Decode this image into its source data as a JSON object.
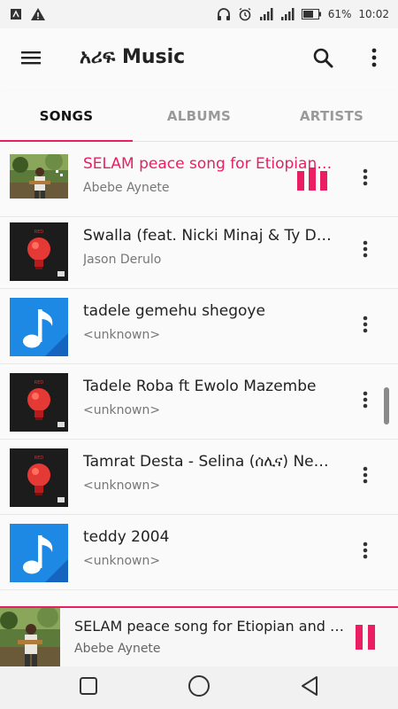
{
  "status_bar": {
    "battery": "61%",
    "time": "10:02",
    "left_icons": [
      "usb-icon",
      "warning-icon"
    ],
    "right_icons": [
      "headphones-icon",
      "alarm-icon",
      "signal-icon",
      "signal-icon",
      "battery-icon"
    ]
  },
  "app_bar": {
    "title": "አሪፍ Music",
    "icons": [
      "menu-icon",
      "search-icon",
      "more-vert-icon"
    ]
  },
  "tabs": [
    {
      "label": "SONGS",
      "active": true
    },
    {
      "label": "ALBUMS",
      "active": false
    },
    {
      "label": "ARTISTS",
      "active": false
    }
  ],
  "songs": [
    {
      "title": "SELAM peace song for Etiopian and Eritrean",
      "artist": "Abebe Aynete",
      "art": "photo",
      "playing": true
    },
    {
      "title": "Swalla (feat. Nicki Minaj & Ty Dolla $ign)",
      "artist": "Jason Derulo",
      "art": "red-bulb",
      "playing": false
    },
    {
      "title": "tadele gemehu shegoye",
      "artist": "<unknown>",
      "art": "music-note",
      "playing": false
    },
    {
      "title": "Tadele Roba ft Ewolo Mazembe",
      "artist": "<unknown>",
      "art": "red-bulb",
      "playing": false
    },
    {
      "title": "Tamrat Desta - Selina (ሰሊና) New Song",
      "artist": "<unknown>",
      "art": "red-bulb",
      "playing": false
    },
    {
      "title": "teddy 2004",
      "artist": "<unknown>",
      "art": "music-note",
      "playing": false
    }
  ],
  "now_playing": {
    "title": "SELAM peace song for Etiopian and Eritrean",
    "artist": "Abebe Aynete"
  },
  "colors": {
    "accent": "#e91e63",
    "note_blue": "#1e88e5",
    "bulb_red": "#e53935"
  },
  "nav_bar": {
    "icons": [
      "recents-icon",
      "home-icon",
      "back-icon"
    ]
  }
}
